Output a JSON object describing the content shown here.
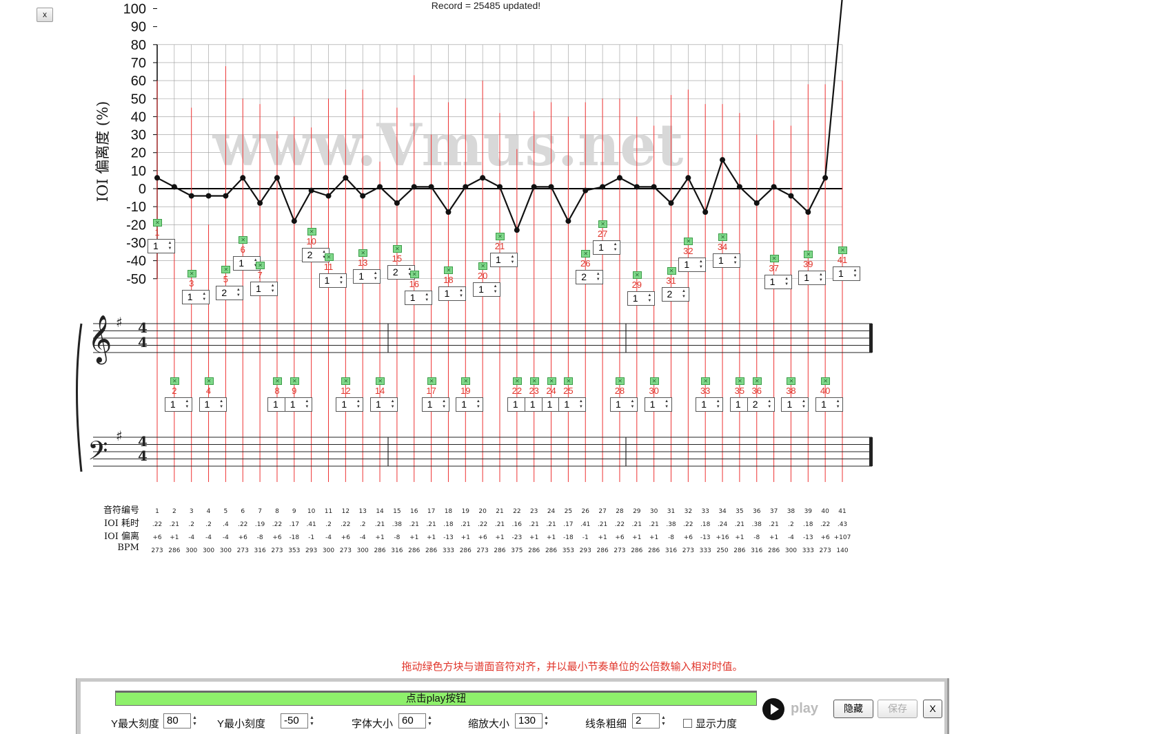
{
  "close_label": "x",
  "record_text": "Record = 25485 updated!",
  "watermark": "www.Vmus.net",
  "chart_data": {
    "type": "line",
    "ylabel": "IOI 偏离度 (%)",
    "ylim": [
      -50,
      100
    ],
    "ymax_visible": 80,
    "yticks": [
      100,
      90,
      80,
      70,
      60,
      50,
      40,
      30,
      20,
      10,
      0,
      -10,
      -20,
      -30,
      -40,
      -50
    ],
    "note_numbers": [
      "1",
      "2",
      "3",
      "4",
      "5",
      "6",
      "7",
      "8",
      "9",
      "10",
      "11",
      "12",
      "13",
      "14",
      "15",
      "16",
      "17",
      "18",
      "19",
      "20",
      "21",
      "22",
      "23",
      "24",
      "25",
      "26",
      "27",
      "28",
      "29",
      "30",
      "31",
      "32",
      "33",
      "34",
      "35",
      "36",
      "37",
      "38",
      "39",
      "40",
      "41"
    ],
    "ioi_time": [
      ".22",
      ".21",
      ".2",
      ".2",
      ".4",
      ".22",
      ".19",
      ".22",
      ".17",
      ".41",
      ".2",
      ".22",
      ".2",
      ".21",
      ".38",
      ".21",
      ".21",
      ".18",
      ".21",
      ".22",
      ".21",
      ".16",
      ".21",
      ".21",
      ".17",
      ".41",
      ".21",
      ".22",
      ".21",
      ".21",
      ".38",
      ".22",
      ".18",
      ".24",
      ".21",
      ".38",
      ".21",
      ".2",
      ".18",
      ".22",
      ".43"
    ],
    "ioi_deviation": [
      "+6",
      "+1",
      "-4",
      "-4",
      "-4",
      "+6",
      "-8",
      "+6",
      "-18",
      "-1",
      "-4",
      "+6",
      "-4",
      "+1",
      "-8",
      "+1",
      "+1",
      "-13",
      "+1",
      "+6",
      "+1",
      "-23",
      "+1",
      "+1",
      "-18",
      "-1",
      "+1",
      "+6",
      "+1",
      "+1",
      "-8",
      "+6",
      "-13",
      "+16",
      "+1",
      "-8",
      "+1",
      "-4",
      "-13",
      "+6",
      "+107"
    ],
    "bpm": [
      "273",
      "286",
      "300",
      "300",
      "300",
      "273",
      "316",
      "273",
      "353",
      "293",
      "300",
      "273",
      "300",
      "286",
      "316",
      "286",
      "286",
      "333",
      "286",
      "273",
      "286",
      "375",
      "286",
      "286",
      "353",
      "293",
      "286",
      "273",
      "286",
      "286",
      "316",
      "273",
      "333",
      "250",
      "286",
      "316",
      "286",
      "300",
      "333",
      "273",
      "140"
    ],
    "values": [
      6,
      1,
      -4,
      -4,
      -4,
      6,
      -8,
      6,
      -18,
      -1,
      -4,
      6,
      -4,
      1,
      -8,
      1,
      1,
      -13,
      1,
      6,
      1,
      -23,
      1,
      1,
      -18,
      -1,
      1,
      6,
      1,
      1,
      -8,
      6,
      -13,
      16,
      1,
      -8,
      1,
      -4,
      -13,
      6,
      107
    ],
    "note_stems": [
      60,
      -30,
      45,
      -20,
      68,
      50,
      47,
      32,
      40,
      34,
      50,
      55,
      55,
      15,
      45,
      63,
      30,
      48,
      50,
      60,
      42,
      22,
      43,
      48,
      40,
      48,
      50,
      50,
      40,
      35,
      52,
      55,
      47,
      47,
      42,
      30,
      38,
      35,
      58,
      58,
      60
    ]
  },
  "rows": {
    "note_number": "音符编号",
    "ioi_time": "IOI 耗时",
    "ioi_deviation": "IOI 偏离",
    "bpm": "BPM"
  },
  "duration_inputs": [
    "1",
    "1",
    "1",
    "1",
    "2",
    "1",
    "1",
    "1",
    "1",
    "2",
    "1",
    "1",
    "1",
    "1",
    "2",
    "1",
    "1",
    "1",
    "1",
    "1",
    "1",
    "1",
    "1",
    "1",
    "1",
    "2",
    "1",
    "1",
    "1",
    "1",
    "2",
    "1",
    "1",
    "1",
    "1",
    "2",
    "1",
    "1",
    "1",
    "1",
    "1"
  ],
  "hint_text": "拖动绿色方块与谱面音符对齐，并以最小节奏单位的公倍数输入相对时值。",
  "toolbar": {
    "progress_label": "点击play按钮",
    "ymax_label": "Y最大刻度",
    "ymax_value": "80",
    "ymin_label": "Y最小刻度",
    "ymin_value": "-50",
    "font_label": "字体大小",
    "font_value": "60",
    "zoom_label": "缩放大小",
    "zoom_value": "130",
    "line_label": "线条粗细",
    "line_value": "2",
    "velocity_label": "显示力度",
    "play_label": "play",
    "hide_label": "隐藏",
    "save_label": "保存",
    "close_label": "X"
  }
}
